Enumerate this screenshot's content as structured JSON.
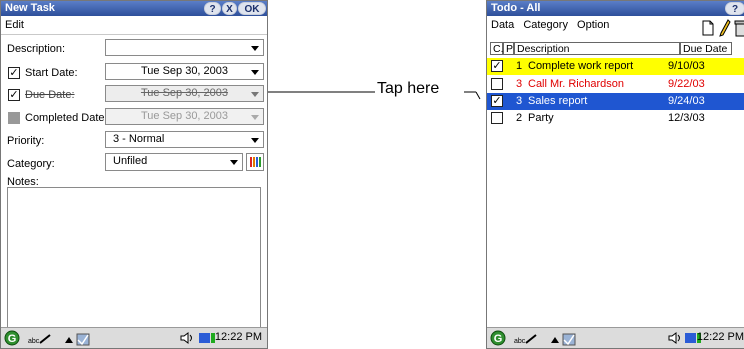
{
  "left_window": {
    "title": "New Task",
    "title_buttons": {
      "help": "?",
      "close": "X",
      "ok": "OK"
    },
    "menu": [
      "Edit"
    ],
    "fields": {
      "description": {
        "label": "Description:",
        "value": ""
      },
      "start_date": {
        "label": "Start Date:",
        "value": "Tue Sep 30, 2003",
        "checked": true
      },
      "due_date": {
        "label": "Due Date:",
        "value": "Tue Sep 30, 2003",
        "checked": true
      },
      "completed_date": {
        "label": "Completed Date:",
        "value": "Tue Sep 30, 2003",
        "checked": false
      },
      "priority": {
        "label": "Priority:",
        "value": "3 - Normal"
      },
      "category": {
        "label": "Category:",
        "value": "Unfiled"
      },
      "notes": {
        "label": "Notes:"
      }
    },
    "statusbar": {
      "clock": "12:22 PM"
    }
  },
  "right_window": {
    "title": "Todo - All",
    "menu": [
      "Data",
      "Category",
      "Option"
    ],
    "columns": {
      "c": "C.",
      "p": "P",
      "description": "Description",
      "due": "Due Date"
    },
    "rows": [
      {
        "checked": true,
        "priority": "1",
        "description": "Complete work report",
        "due": "9/10/03"
      },
      {
        "checked": false,
        "priority": "3",
        "description": "Call Mr. Richardson",
        "due": "9/22/03"
      },
      {
        "checked": true,
        "priority": "3",
        "description": "Sales report",
        "due": "9/24/03"
      },
      {
        "checked": false,
        "priority": "2",
        "description": "Party",
        "due": "12/3/03"
      }
    ],
    "statusbar": {
      "clock": "12:22 PM"
    }
  },
  "callout": {
    "text": "Tap here"
  },
  "colors": {
    "titlebar": "#3a5fad",
    "highlight_yellow": "#ffff00",
    "overdue_red": "#e00000",
    "selected_blue": "#1f56d1"
  }
}
